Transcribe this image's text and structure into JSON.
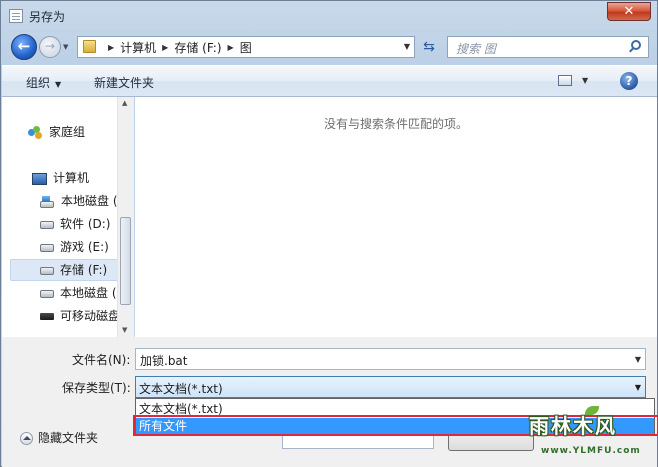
{
  "window": {
    "title": "另存为",
    "close_glyph": "✕"
  },
  "nav": {
    "breadcrumb": [
      "计算机",
      "存储 (F:)",
      "图"
    ],
    "search_placeholder": "搜索 图"
  },
  "toolbar": {
    "organize_label": "组织",
    "new_folder_label": "新建文件夹"
  },
  "sidebar": {
    "items": [
      {
        "label": "家庭组",
        "icon": "homegroup-icon"
      },
      {
        "label": "计算机",
        "icon": "computer-icon"
      },
      {
        "label": "本地磁盘 (C",
        "icon": "system-drive-icon"
      },
      {
        "label": "软件 (D:)",
        "icon": "drive-icon"
      },
      {
        "label": "游戏 (E:)",
        "icon": "drive-icon"
      },
      {
        "label": "存储 (F:)",
        "icon": "drive-icon",
        "selected": true
      },
      {
        "label": "本地磁盘 (C",
        "icon": "drive-icon"
      },
      {
        "label": "可移动磁盘",
        "icon": "usb-drive-icon"
      }
    ]
  },
  "content": {
    "empty_message": "没有与搜索条件匹配的项。"
  },
  "form": {
    "filename_label": "文件名(N):",
    "filename_value": "加锁.bat",
    "filetype_label": "保存类型(T):",
    "filetype_value": "文本文档(*.txt)",
    "filetype_options": [
      "文本文档(*.txt)",
      "所有文件"
    ],
    "filetype_highlighted": "所有文件"
  },
  "footer": {
    "hide_folders_label": "隐藏文件夹"
  },
  "watermark": {
    "text": "雨林木风",
    "url": "www.YLMFU.com"
  }
}
